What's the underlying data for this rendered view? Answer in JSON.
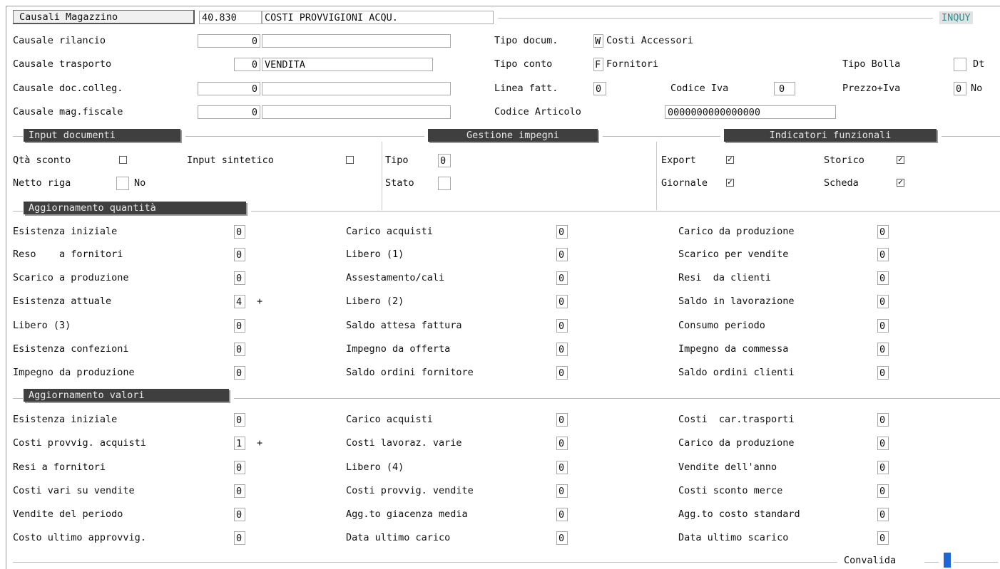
{
  "header": {
    "section_title": "Causali Magazzino",
    "code": "40.830",
    "description": "COSTI PROVVIGIONI ACQU.",
    "mode": "INQUY"
  },
  "top_left": [
    {
      "label": "Causale rilancio",
      "value": "0",
      "desc": ""
    },
    {
      "label": "Causale trasporto",
      "value": "0",
      "desc": "VENDITA"
    },
    {
      "label": "Causale doc.colleg.",
      "value": "0",
      "desc": ""
    },
    {
      "label": "Causale mag.fiscale",
      "value": "0",
      "desc": ""
    }
  ],
  "top_right": {
    "tipo_docum": {
      "label": "Tipo docum.",
      "value": "W",
      "desc": "Costi Accessori"
    },
    "tipo_conto": {
      "label": "Tipo conto",
      "value": "F",
      "desc": "Fornitori"
    },
    "linea_fatt": {
      "label": "Linea fatt.",
      "value": "0"
    },
    "codice_iva": {
      "label": "Codice Iva",
      "value": "0"
    },
    "codice_articolo": {
      "label": "Codice Articolo",
      "value": "0000000000000000"
    },
    "tipo_bolla": {
      "label": "Tipo Bolla",
      "value": "",
      "suffix": "Dt"
    },
    "prezzo_iva": {
      "label": "Prezzo+Iva",
      "value": "0",
      "suffix": "No"
    }
  },
  "input_documenti": {
    "title": "Input documenti",
    "qta_sconto": {
      "label": "Qtà sconto",
      "checked": false
    },
    "input_sintetico": {
      "label": "Input sintetico",
      "checked": false
    },
    "netto_riga": {
      "label": "Netto riga",
      "value": "",
      "suffix": "No"
    }
  },
  "gestione_impegni": {
    "title": "Gestione impegni",
    "tipo": {
      "label": "Tipo",
      "value": "0"
    },
    "stato": {
      "label": "Stato",
      "value": ""
    }
  },
  "indicatori": {
    "title": "Indicatori funzionali",
    "export": {
      "label": "Export",
      "checked": true
    },
    "storico": {
      "label": "Storico",
      "checked": true
    },
    "giornale": {
      "label": "Giornale",
      "checked": true
    },
    "scheda": {
      "label": "Scheda",
      "checked": true
    }
  },
  "quantita": {
    "title": "Aggiornamento quantità",
    "col1": [
      {
        "label": "Esistenza iniziale",
        "value": "0",
        "sign": ""
      },
      {
        "label": "Reso    a fornitori",
        "value": "0",
        "sign": ""
      },
      {
        "label": "Scarico a produzione",
        "value": "0",
        "sign": ""
      },
      {
        "label": "Esistenza attuale",
        "value": "4",
        "sign": "+"
      },
      {
        "label": "Libero (3)",
        "value": "0",
        "sign": ""
      },
      {
        "label": "Esistenza confezioni",
        "value": "0",
        "sign": ""
      },
      {
        "label": "Impegno da produzione",
        "value": "0",
        "sign": ""
      }
    ],
    "col2": [
      {
        "label": "Carico acquisti",
        "value": "0"
      },
      {
        "label": "Libero (1)",
        "value": "0"
      },
      {
        "label": "Assestamento/cali",
        "value": "0"
      },
      {
        "label": "Libero (2)",
        "value": "0"
      },
      {
        "label": "Saldo attesa fattura",
        "value": "0"
      },
      {
        "label": "Impegno da offerta",
        "value": "0"
      },
      {
        "label": "Saldo ordini fornitore",
        "value": "0"
      }
    ],
    "col3": [
      {
        "label": "Carico da produzione",
        "value": "0"
      },
      {
        "label": "Scarico per vendite",
        "value": "0"
      },
      {
        "label": "Resi  da clienti",
        "value": "0"
      },
      {
        "label": "Saldo in lavorazione",
        "value": "0"
      },
      {
        "label": "Consumo periodo",
        "value": "0"
      },
      {
        "label": "Impegno da commessa",
        "value": "0"
      },
      {
        "label": "Saldo ordini clienti",
        "value": "0"
      }
    ]
  },
  "valori": {
    "title": "Aggiornamento valori",
    "col1": [
      {
        "label": "Esistenza iniziale",
        "value": "0",
        "sign": ""
      },
      {
        "label": "Costi provvig. acquisti",
        "value": "1",
        "sign": "+"
      },
      {
        "label": "Resi a fornitori",
        "value": "0",
        "sign": ""
      },
      {
        "label": "Costi vari su vendite",
        "value": "0",
        "sign": ""
      },
      {
        "label": "Vendite del periodo",
        "value": "0",
        "sign": ""
      },
      {
        "label": "Costo ultimo approvvig.",
        "value": "0",
        "sign": ""
      }
    ],
    "col2": [
      {
        "label": "Carico acquisti",
        "value": "0"
      },
      {
        "label": "Costi lavoraz. varie",
        "value": "0"
      },
      {
        "label": "Libero (4)",
        "value": "0"
      },
      {
        "label": "Costi provvig. vendite",
        "value": "0"
      },
      {
        "label": "Agg.to giacenza media",
        "value": "0"
      },
      {
        "label": "Data ultimo carico",
        "value": "0"
      }
    ],
    "col3": [
      {
        "label": "Costi  car.trasporti",
        "value": "0"
      },
      {
        "label": "Carico da produzione",
        "value": "0"
      },
      {
        "label": "Vendite dell'anno",
        "value": "0"
      },
      {
        "label": "Costi sconto merce",
        "value": "0"
      },
      {
        "label": "Agg.to costo standard",
        "value": "0"
      },
      {
        "label": "Data ultimo scarico",
        "value": "0"
      }
    ]
  },
  "footer": {
    "convalida_label": "Convalida"
  },
  "colors": {
    "header_bg": "#3f3f3f",
    "header_fg": "#e8e8e8",
    "inquy": "#2f8f8f",
    "cursor": "#1e66d6"
  }
}
